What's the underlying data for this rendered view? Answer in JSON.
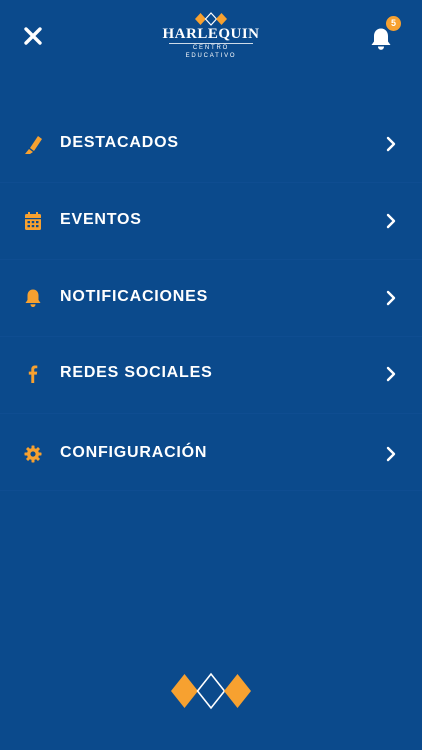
{
  "header": {
    "logo_title": "HARLEQUIN",
    "logo_subtitle": "CENTRO EDUCATIVO",
    "notification_count": "5"
  },
  "menu": {
    "items": [
      {
        "label": "DESTACADOS",
        "icon": "highlighter-icon"
      },
      {
        "label": "EVENTOS",
        "icon": "calendar-icon"
      },
      {
        "label": "NOTIFICACIONES",
        "icon": "bell-icon"
      },
      {
        "label": "REDES SOCIALES",
        "icon": "facebook-icon"
      },
      {
        "label": "CONFIGURACIÓN",
        "icon": "gear-icon"
      }
    ]
  },
  "colors": {
    "background": "#0b4a8c",
    "accent": "#f7a130",
    "text": "#ffffff"
  }
}
